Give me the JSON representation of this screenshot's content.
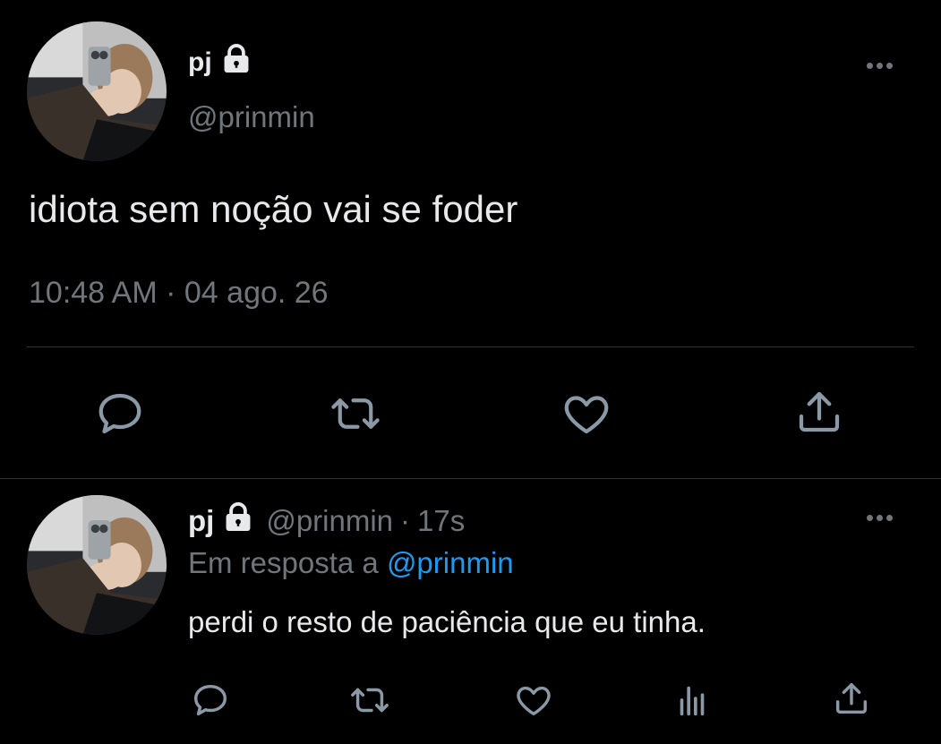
{
  "main_tweet": {
    "display_name": "pj",
    "handle": "@prinmin",
    "text": "idiota sem noção vai se foder",
    "time": "10:48 AM",
    "separator": "·",
    "date": "04 ago. 26",
    "actions": [
      "reply-icon",
      "retweet-icon",
      "like-icon",
      "share-icon"
    ]
  },
  "reply_tweet": {
    "display_name": "pj",
    "handle": "@prinmin",
    "time_sep": "·",
    "relative_time": "17s",
    "in_reply_prefix": "Em resposta a",
    "in_reply_mention": "@prinmin",
    "text": "perdi o resto de paciência que eu tinha.",
    "actions": [
      "reply-icon",
      "retweet-icon",
      "like-icon",
      "analytics-icon",
      "share-icon"
    ]
  },
  "colors": {
    "background": "#000000",
    "text": "#e7e9ea",
    "secondary": "#71767b",
    "accent": "#1d9bf0",
    "divider": "#2f3336"
  }
}
